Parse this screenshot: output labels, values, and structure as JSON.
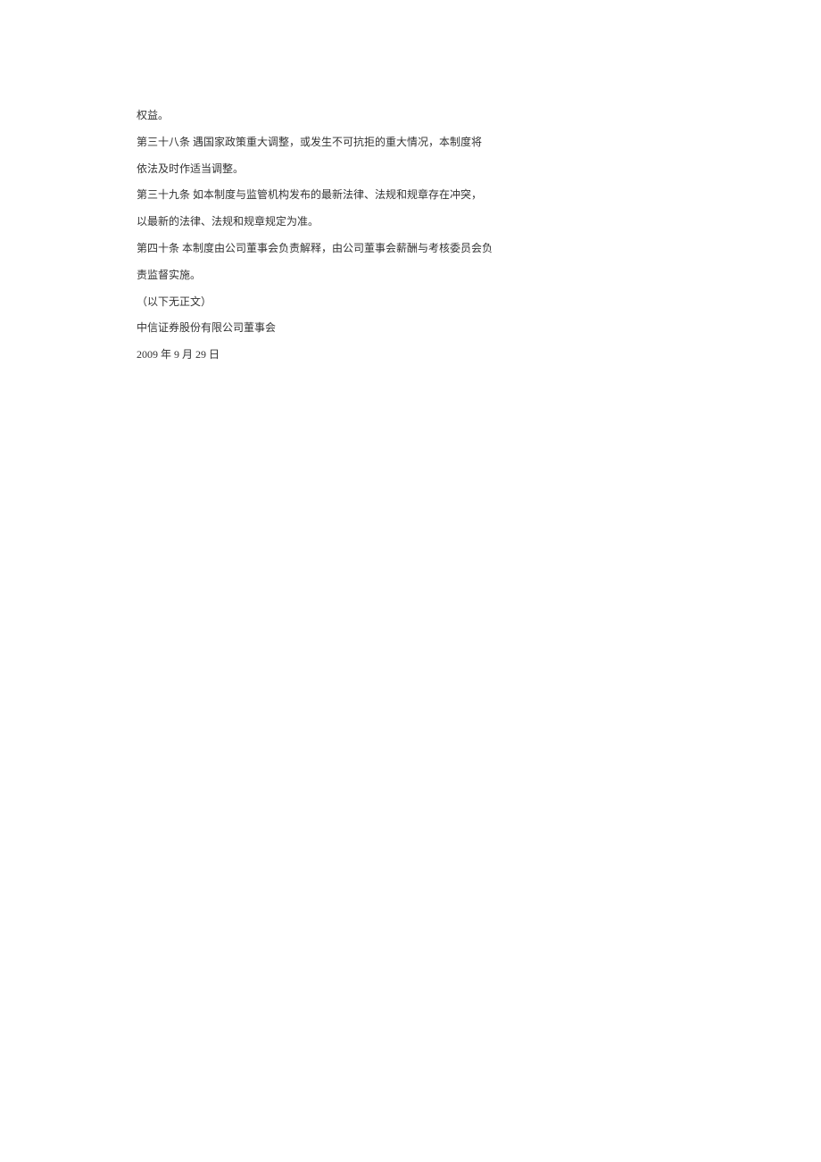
{
  "document": {
    "paragraphs": [
      "权益。",
      "第三十八条  遇国家政策重大调整，或发生不可抗拒的重大情况，本制度将",
      "依法及时作适当调整。",
      "第三十九条  如本制度与监管机构发布的最新法律、法规和规章存在冲突，",
      "以最新的法律、法规和规章规定为准。",
      "第四十条  本制度由公司董事会负责解释，由公司董事会薪酬与考核委员会负",
      "责监督实施。",
      "（以下无正文）",
      "中信证券股份有限公司董事会",
      "2009 年 9 月 29 日"
    ]
  }
}
